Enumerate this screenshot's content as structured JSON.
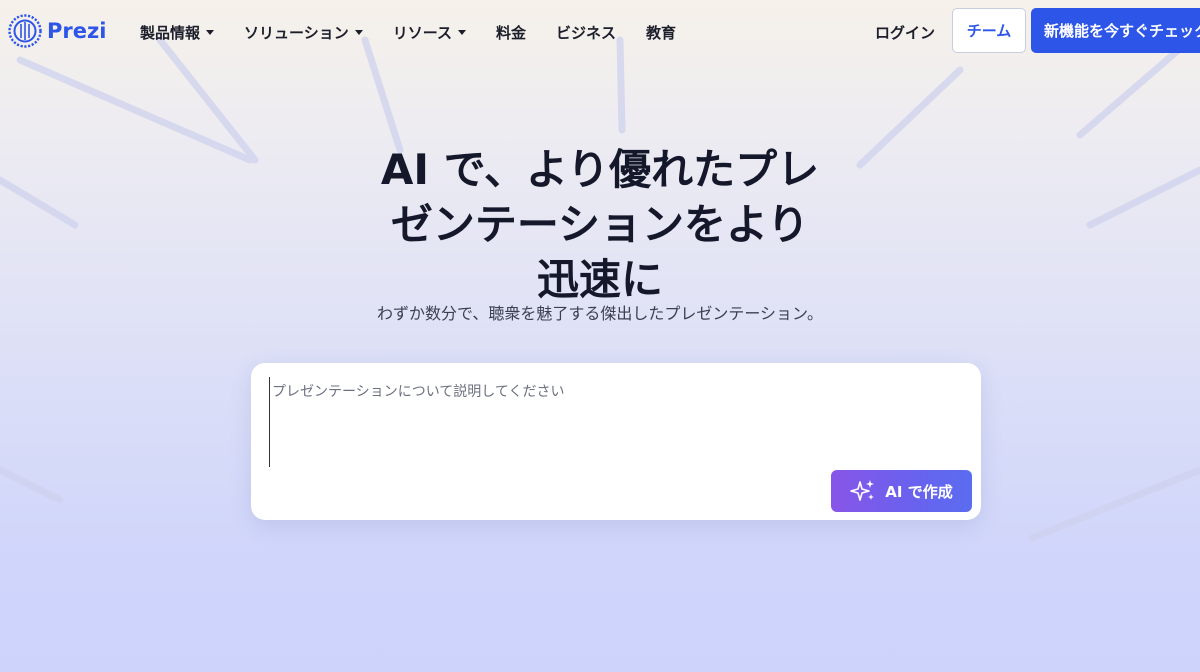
{
  "brand": {
    "name": "Prezi",
    "color": "#2d55e8"
  },
  "nav": {
    "items": [
      {
        "label": "製品情報",
        "has_dropdown": true
      },
      {
        "label": "ソリューション",
        "has_dropdown": true
      },
      {
        "label": "リソース",
        "has_dropdown": true
      },
      {
        "label": "料金",
        "has_dropdown": false
      },
      {
        "label": "ビジネス",
        "has_dropdown": false
      },
      {
        "label": "教育",
        "has_dropdown": false
      }
    ],
    "login_label": "ログイン",
    "team_label": "チーム",
    "cta_label": "新機能を今すぐチェック"
  },
  "hero": {
    "title_lines": [
      "AI で、より優れたプレ",
      "ゼンテーションをより",
      "迅速に"
    ],
    "subtitle": "わずか数分で、聴衆を魅了する傑出したプレゼンテーション。"
  },
  "prompt": {
    "placeholder": "プレゼンテーションについて説明してください",
    "value": "",
    "button_label": "AI で作成",
    "button_icon": "sparkle-icon"
  },
  "colors": {
    "accent": "#2d55e8",
    "ai_gradient_start": "#8855e8",
    "ai_gradient_end": "#5a6cf0",
    "text_dark": "#14182a"
  }
}
